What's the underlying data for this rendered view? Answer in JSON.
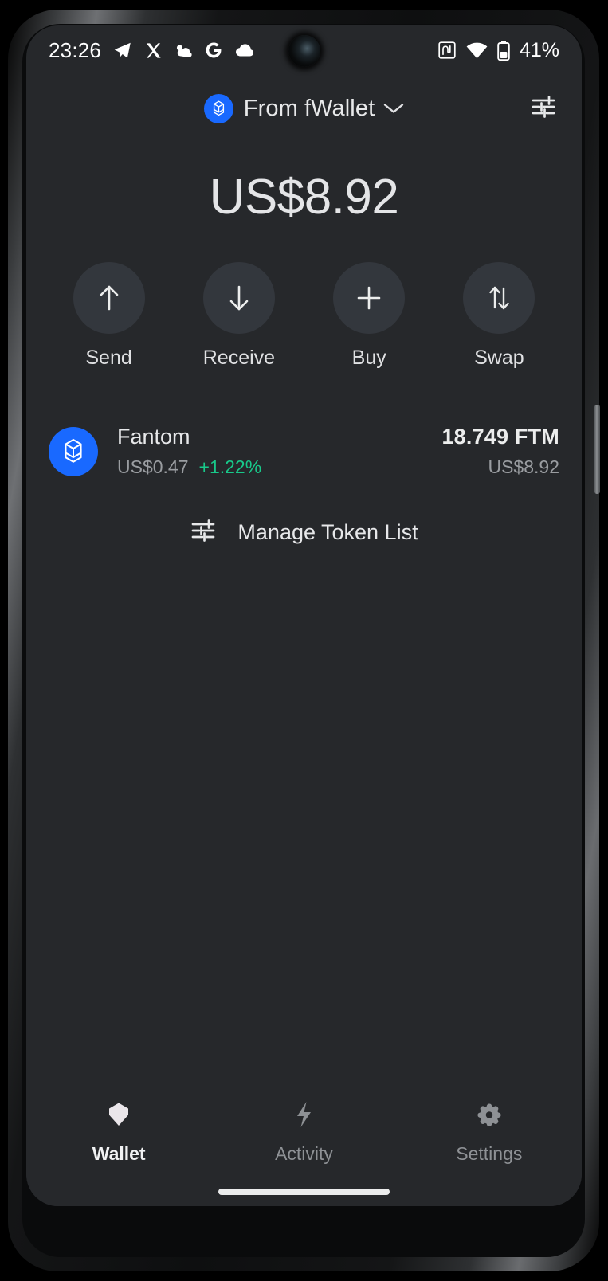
{
  "statusbar": {
    "time": "23:26",
    "battery_text": "41%",
    "left_icons": [
      "telegram-icon",
      "x-twitter-icon",
      "weather-partly-cloudy-icon",
      "google-g-icon",
      "cloud-icon"
    ],
    "right_icons": [
      "nfc-icon",
      "wifi-icon",
      "battery-icon"
    ]
  },
  "header": {
    "wallet_label": "From fWallet",
    "wallet_icon": "fantom-logo-icon",
    "chevron_icon": "chevron-down-icon",
    "tune_icon": "tune-sliders-icon"
  },
  "balance": {
    "total": "US$8.92"
  },
  "actions": [
    {
      "label": "Send",
      "icon": "arrow-up-icon"
    },
    {
      "label": "Receive",
      "icon": "arrow-down-icon"
    },
    {
      "label": "Buy",
      "icon": "plus-icon"
    },
    {
      "label": "Swap",
      "icon": "swap-arrows-icon"
    }
  ],
  "tokens": [
    {
      "name": "Fantom",
      "logo": "fantom-logo-icon",
      "price": "US$0.47",
      "change": "+1.22%",
      "amount": "18.749 FTM",
      "value": "US$8.92"
    }
  ],
  "manage": {
    "label": "Manage Token List",
    "icon": "tune-sliders-icon"
  },
  "bottom_nav": [
    {
      "label": "Wallet",
      "icon": "gem-diamond-icon",
      "active": true
    },
    {
      "label": "Activity",
      "icon": "lightning-bolt-icon",
      "active": false
    },
    {
      "label": "Settings",
      "icon": "gear-icon",
      "active": false
    }
  ],
  "colors": {
    "accent_blue": "#1969ff",
    "positive_green": "#18c98a",
    "app_background": "#26282b",
    "action_circle": "#33373d"
  }
}
